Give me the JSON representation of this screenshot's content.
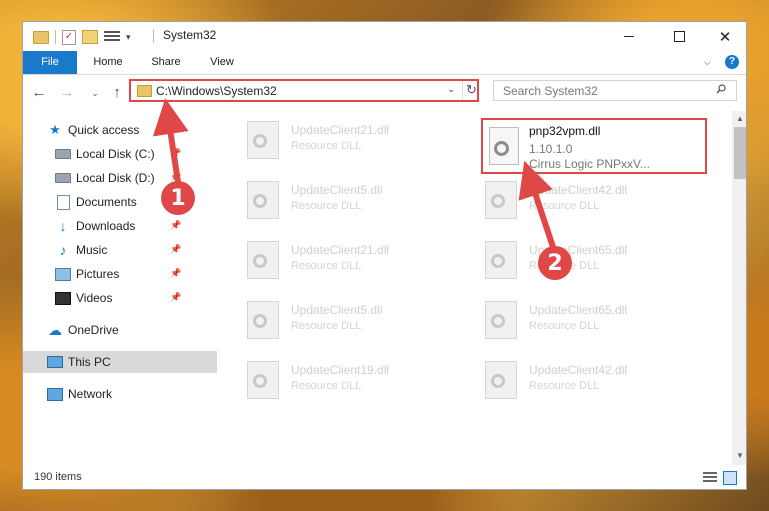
{
  "window": {
    "title": "System32",
    "min_label": "—",
    "close_label": "✕"
  },
  "ribbon": {
    "tabs": [
      "File",
      "Home",
      "Share",
      "View"
    ],
    "help_label": "?"
  },
  "address": {
    "path": "C:\\Windows\\System32",
    "search_placeholder": "Search System32"
  },
  "sidebar": {
    "items": [
      {
        "label": "Quick access",
        "icon": "star-icon"
      },
      {
        "label": "Local Disk (C:)",
        "icon": "drive-icon"
      },
      {
        "label": "Local Disk (D:)",
        "icon": "drive-icon"
      },
      {
        "label": "Documents",
        "icon": "documents-icon"
      },
      {
        "label": "Downloads",
        "icon": "download-icon"
      },
      {
        "label": "Music",
        "icon": "music-icon"
      },
      {
        "label": "Pictures",
        "icon": "pictures-icon"
      },
      {
        "label": "Videos",
        "icon": "videos-icon"
      },
      {
        "label": "OneDrive",
        "icon": "cloud-icon"
      },
      {
        "label": "This PC",
        "icon": "computer-icon"
      },
      {
        "label": "Network",
        "icon": "network-icon"
      }
    ]
  },
  "files": [
    {
      "name": "UpdateClient21.dll",
      "type": "Resource DLL"
    },
    {
      "name": "UpdateClient5.dll",
      "type": "Resource DLL"
    },
    {
      "name": "UpdateClient42.dll",
      "type": "Resource DLL"
    },
    {
      "name": "UpdateClient21.dll",
      "type": "Resource DLL"
    },
    {
      "name": "UpdateClient65.dll",
      "type": "Resource DLL"
    },
    {
      "name": "UpdateClient5.dll",
      "type": "Resource DLL"
    },
    {
      "name": "UpdateClient65.dll",
      "type": "Resource DLL"
    },
    {
      "name": "UpdateClient19.dll",
      "type": "Resource DLL"
    },
    {
      "name": "UpdateClient42.dll",
      "type": "Resource DLL"
    }
  ],
  "highlighted_file": {
    "name": "pnp32vpm.dll",
    "version": "1.10.1.0",
    "description": "Cirrus Logic PNPxxV..."
  },
  "status": {
    "item_count": "190 items"
  },
  "callouts": [
    "1",
    "2"
  ],
  "colors": {
    "accent": "#1979ca",
    "highlight": "#e04848",
    "selected_nav": "#d9d9d9"
  }
}
